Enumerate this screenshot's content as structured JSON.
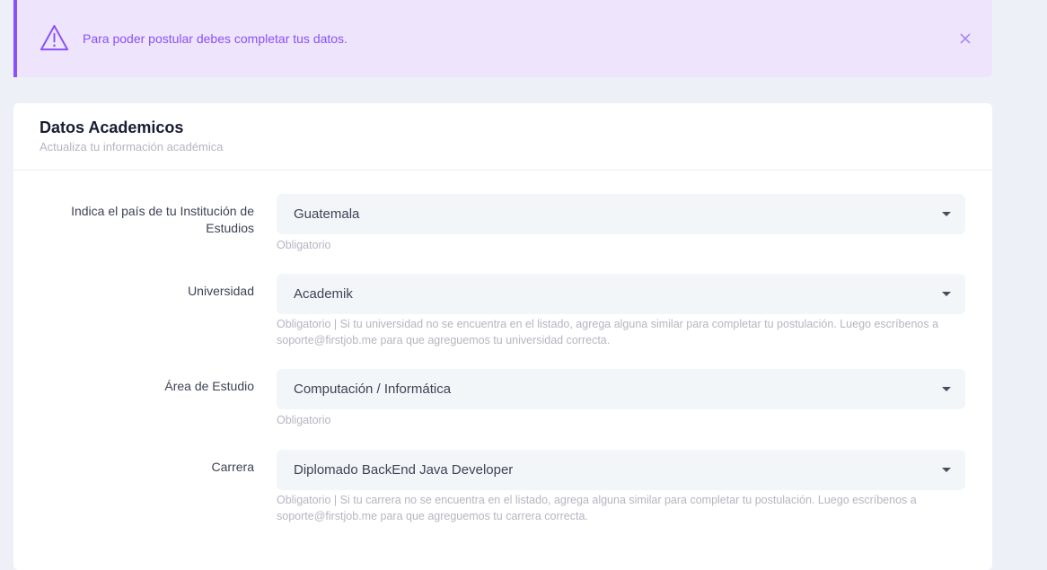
{
  "alert": {
    "message": "Para poder postular debes completar tus datos.",
    "icon": "warning-icon",
    "close_icon": "close-icon",
    "accent_color": "#8950fc",
    "background_color": "#eee5fd"
  },
  "card": {
    "title": "Datos Academicos",
    "subtitle": "Actualiza tu información académica"
  },
  "fields": [
    {
      "label": "Indica el país de tu Institución de Estudios",
      "value": "Guatemala",
      "help": "Obligatorio"
    },
    {
      "label": "Universidad",
      "value": "Academik",
      "help": "Obligatorio | Si tu universidad no se encuentra en el listado, agrega alguna similar para completar tu postulación. Luego escríbenos a soporte@firstjob.me para que agreguemos tu universidad correcta."
    },
    {
      "label": "Área de Estudio",
      "value": "Computación / Informática",
      "help": "Obligatorio"
    },
    {
      "label": "Carrera",
      "value": "Diplomado BackEnd Java Developer",
      "help": "Obligatorio | Si tu carrera no se encuentra en el listado, agrega alguna similar para completar tu postulación. Luego escríbenos a soporte@firstjob.me para que agreguemos tu carrera correcta."
    }
  ]
}
